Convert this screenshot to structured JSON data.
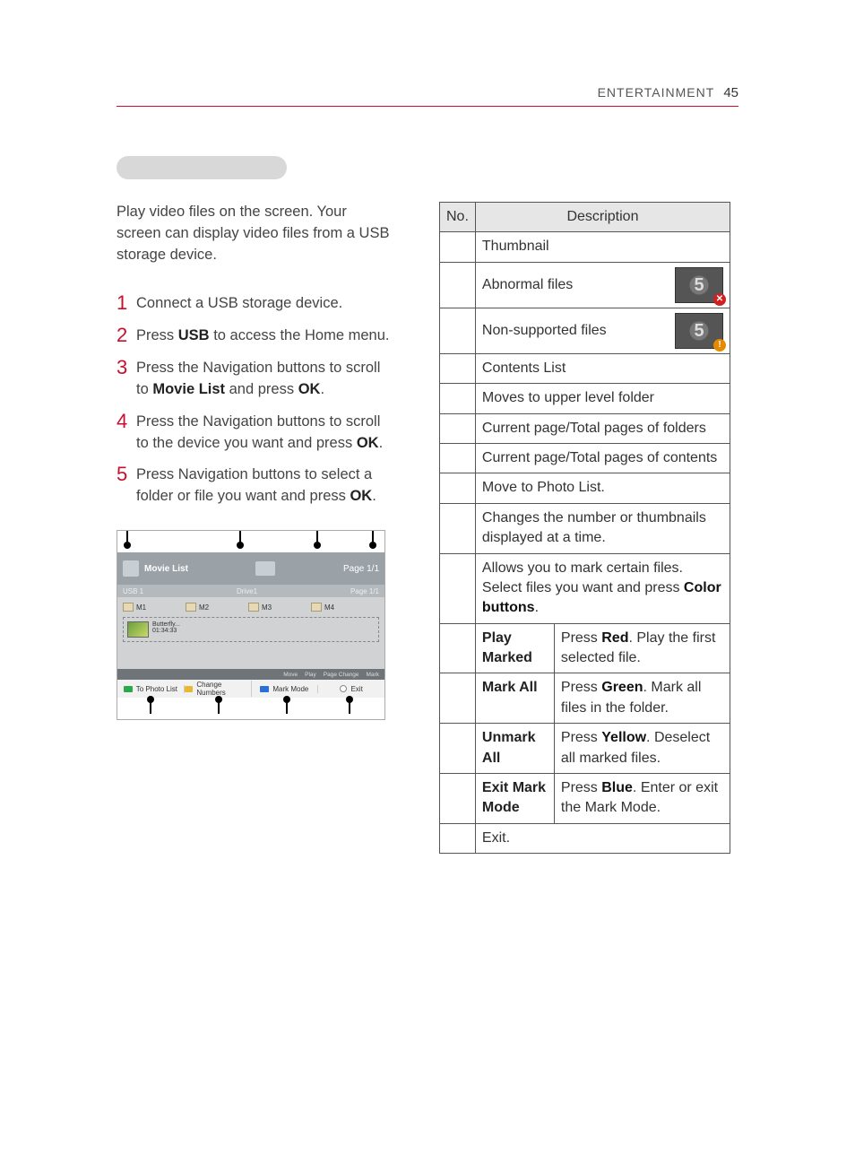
{
  "header": {
    "section": "ENTERTAINMENT",
    "page": "45"
  },
  "intro": "Play video files on the screen. Your screen can display video files from a USB storage device.",
  "steps": [
    {
      "num": "1",
      "text_html": "Connect a USB storage device."
    },
    {
      "num": "2",
      "text_html": "Press <b>USB</b> to access the Home menu."
    },
    {
      "num": "3",
      "text_html": "Press the Navigation buttons to scroll to <b>Movie List</b> and press <b>OK</b>."
    },
    {
      "num": "4",
      "text_html": "Press the Navigation buttons to scroll to the device you want and press <b>OK</b>."
    },
    {
      "num": "5",
      "text_html": "Press Navigation buttons to select a folder or file you want and press <b>OK</b>."
    }
  ],
  "screenshot": {
    "title": "Movie List",
    "page": "Page 1/1",
    "usb_label": "USB 1",
    "drive_label": "Drive1",
    "page2_label": "Page 1/1",
    "folders": [
      "M1",
      "M2",
      "M3",
      "M4"
    ],
    "file_name": "Butterfly...",
    "file_dur": "01:34:33",
    "hints": [
      "Move",
      "Play",
      "Page Change",
      "Mark"
    ],
    "footer": [
      "To Photo List",
      "Change Numbers",
      "Mark Mode",
      "Exit"
    ]
  },
  "table": {
    "head_no": "No.",
    "head_desc": "Description",
    "rows": [
      {
        "type": "plain",
        "text": "Thumbnail"
      },
      {
        "type": "thumb",
        "text": "Abnormal files",
        "icon": "x",
        "digit": "5"
      },
      {
        "type": "thumb",
        "text": "Non-supported files",
        "icon": "warn",
        "digit": "5"
      },
      {
        "type": "plain",
        "text": "Contents List"
      },
      {
        "type": "plain",
        "text": "Moves to upper level folder"
      },
      {
        "type": "plain",
        "text": "Current page/Total pages of folders"
      },
      {
        "type": "plain",
        "text": "Current page/Total pages of contents"
      },
      {
        "type": "plain",
        "text": "Move to Photo List."
      },
      {
        "type": "plain",
        "text": "Changes the number or thumbnails displayed at a time."
      },
      {
        "type": "rich",
        "text_html": "Allows you to mark certain files. Select files you want and press <b>Color buttons</b>."
      },
      {
        "type": "sub",
        "label": "Play Marked",
        "text_html": "Press <b>Red</b>. Play the first selected file."
      },
      {
        "type": "sub",
        "label": "Mark All",
        "text_html": "Press <b>Green</b>. Mark all files in the folder."
      },
      {
        "type": "sub",
        "label": "Unmark All",
        "text_html": "Press <b>Yellow</b>. Deselect all marked files."
      },
      {
        "type": "sub",
        "label": "Exit Mark Mode",
        "text_html": "Press <b>Blue</b>. Enter or exit the Mark Mode."
      },
      {
        "type": "plain",
        "text": "Exit."
      }
    ]
  }
}
